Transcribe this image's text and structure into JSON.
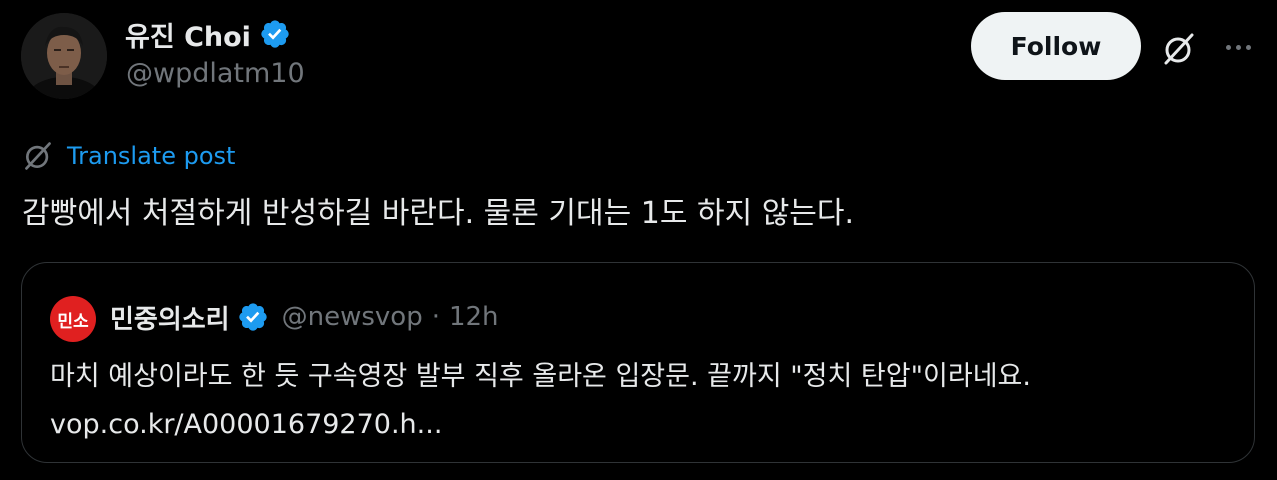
{
  "post": {
    "author": {
      "display_name": "유진 Choi",
      "handle": "@wpdlatm10",
      "verified": true
    },
    "follow_label": "Follow",
    "translate_label": "Translate post",
    "text": "감빵에서 처절하게 반성하길 바란다. 물론 기대는 1도 하지 않는다.",
    "quote": {
      "avatar_text": "민소",
      "author_name": "민중의소리",
      "handle": "@newsvop",
      "separator": "·",
      "time": "12h",
      "verified": true,
      "text_line1": "마치 예상이라도 한 듯 구속영장 발부 직후 올라온 입장문. 끝까지 \"정치 탄압\"이라네요.",
      "text_line2": "vop.co.kr/A00001679270.h..."
    }
  },
  "colors": {
    "background": "#000000",
    "text_primary": "#e7e9ea",
    "text_secondary": "#71767b",
    "accent_blue": "#1d9bf0",
    "follow_button_bg": "#eff3f4",
    "quote_border": "#2f3336",
    "news_brand_red": "#e02020"
  },
  "icons": {
    "verified": "verified-badge-icon",
    "grok": "grok-icon",
    "more": "more-dots-icon",
    "translate": "grok-translate-icon"
  }
}
